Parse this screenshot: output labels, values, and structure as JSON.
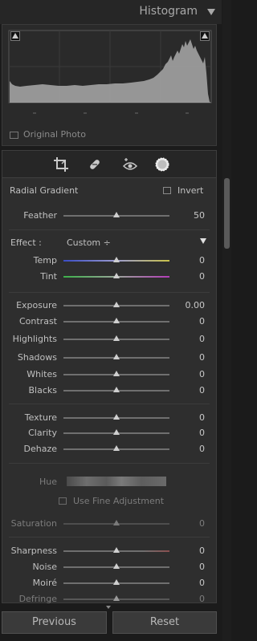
{
  "histogram": {
    "title": "Histogram",
    "original_photo_label": "Original Photo"
  },
  "tools": {
    "icons": [
      "crop-icon",
      "healing-brush-icon",
      "red-eye-icon",
      "mask-icon"
    ]
  },
  "radial": {
    "title": "Radial Gradient",
    "invert_label": "Invert",
    "feather_label": "Feather",
    "feather_value": "50"
  },
  "effect": {
    "label": "Effect :",
    "preset": "Custom ÷"
  },
  "sliders": {
    "temp": {
      "label": "Temp",
      "value": "0"
    },
    "tint": {
      "label": "Tint",
      "value": "0"
    },
    "exposure": {
      "label": "Exposure",
      "value": "0.00"
    },
    "contrast": {
      "label": "Contrast",
      "value": "0"
    },
    "highlights": {
      "label": "Highlights",
      "value": "0"
    },
    "shadows": {
      "label": "Shadows",
      "value": "0"
    },
    "whites": {
      "label": "Whites",
      "value": "0"
    },
    "blacks": {
      "label": "Blacks",
      "value": "0"
    },
    "texture": {
      "label": "Texture",
      "value": "0"
    },
    "clarity": {
      "label": "Clarity",
      "value": "0"
    },
    "dehaze": {
      "label": "Dehaze",
      "value": "0"
    },
    "hue": {
      "label": "Hue"
    },
    "fine_adjust": {
      "label": "Use Fine Adjustment"
    },
    "saturation": {
      "label": "Saturation",
      "value": "0"
    },
    "sharpness": {
      "label": "Sharpness",
      "value": "0"
    },
    "noise": {
      "label": "Noise",
      "value": "0"
    },
    "moire": {
      "label": "Moiré",
      "value": "0"
    },
    "defringe": {
      "label": "Defringe",
      "value": "0"
    }
  },
  "buttons": {
    "previous": "Previous",
    "reset": "Reset"
  },
  "colors": {
    "panel": "#2e2e2e",
    "temp_gradient": [
      "#3a4cc4",
      "#c9c24a"
    ],
    "tint_gradient": [
      "#3cb04a",
      "#b33cb8"
    ]
  }
}
